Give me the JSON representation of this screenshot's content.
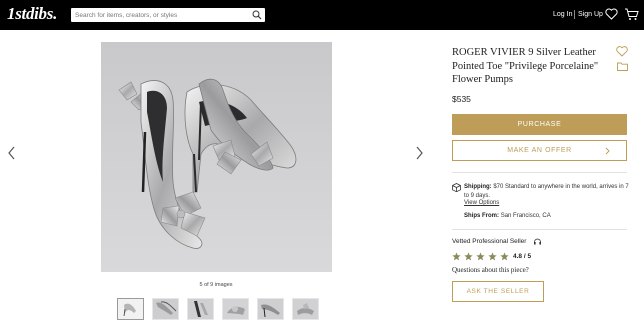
{
  "header": {
    "logo": "1stdibs.",
    "search_placeholder": "Search for items, creators, or styles",
    "login_label": "Log In",
    "signup_label": "Sign Up",
    "icons": [
      "search-icon",
      "heart-icon",
      "cart-icon"
    ]
  },
  "gallery": {
    "counter": "5 of 9 images",
    "thumbnail_count": 6,
    "active_thumbnail": 1,
    "prev_icon": "chevron-left-icon",
    "next_icon": "chevron-right-icon"
  },
  "product": {
    "title": "ROGER VIVIER 9 Silver Leather Pointed Toe \"Privilege Porcelaine\" Flower Pumps",
    "price": "$535",
    "purchase_label": "PURCHASE",
    "offer_label": "MAKE AN OFFER",
    "shipping_label": "Shipping:",
    "shipping_text": "$70 Standard to anywhere in the world, arrives in 7 to 9 days.",
    "view_options": "View Options",
    "ships_from_label": "Ships From:",
    "ships_from_value": "San Francisco, CA"
  },
  "seller": {
    "vetted_label": "Vetted Professional Seller",
    "rating": "4.8 / 5",
    "rating_value": 4.8,
    "rating_max": 5,
    "question": "Questions about this piece?",
    "ask_label": "ASK THE SELLER"
  },
  "colors": {
    "topbar": "#000000",
    "accent_gold": "#bd9d57",
    "star": "#8a8a5a"
  }
}
